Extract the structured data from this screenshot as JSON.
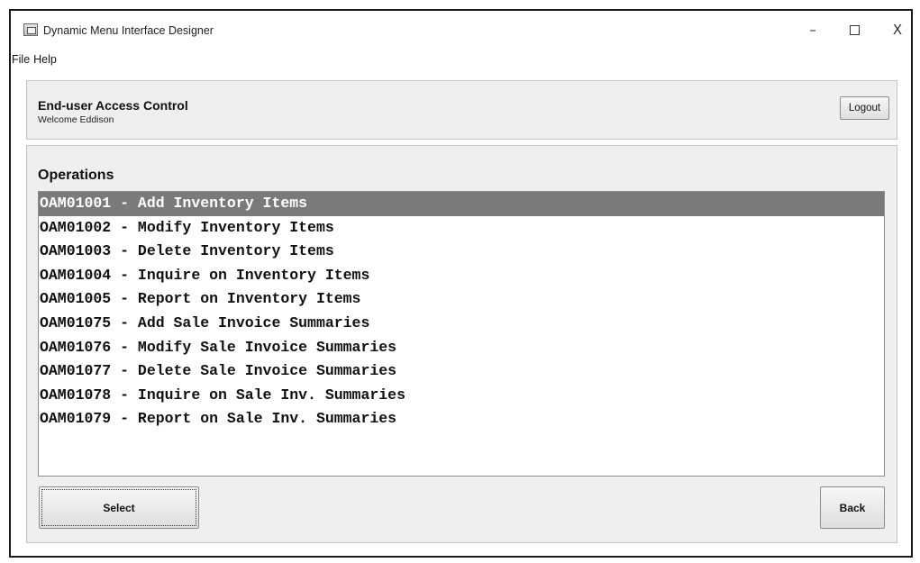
{
  "window": {
    "title": "Dynamic Menu Interface Designer",
    "controls": {
      "minimize": "–",
      "close": "X"
    }
  },
  "menubar": {
    "items": [
      "File",
      "Help"
    ]
  },
  "header": {
    "title": "End-user Access Control",
    "welcome": "Welcome Eddison",
    "logout_label": "Logout"
  },
  "operations": {
    "title": "Operations",
    "selected_index": 0,
    "items": [
      "OAM01001 - Add Inventory Items",
      "OAM01002 - Modify Inventory Items",
      "OAM01003 - Delete Inventory Items",
      "OAM01004 - Inquire on Inventory Items",
      "OAM01005 - Report on Inventory Items",
      "OAM01075 - Add Sale Invoice Summaries",
      "OAM01076 - Modify Sale Invoice Summaries",
      "OAM01077 - Delete Sale Invoice Summaries",
      "OAM01078 - Inquire on Sale Inv. Summaries",
      "OAM01079 - Report on Sale Inv. Summaries"
    ]
  },
  "actions": {
    "select_label": "Select",
    "back_label": "Back"
  },
  "colors": {
    "selection": "#7a7a7a",
    "panel": "#efefef",
    "list_bg": "#ffffff"
  }
}
